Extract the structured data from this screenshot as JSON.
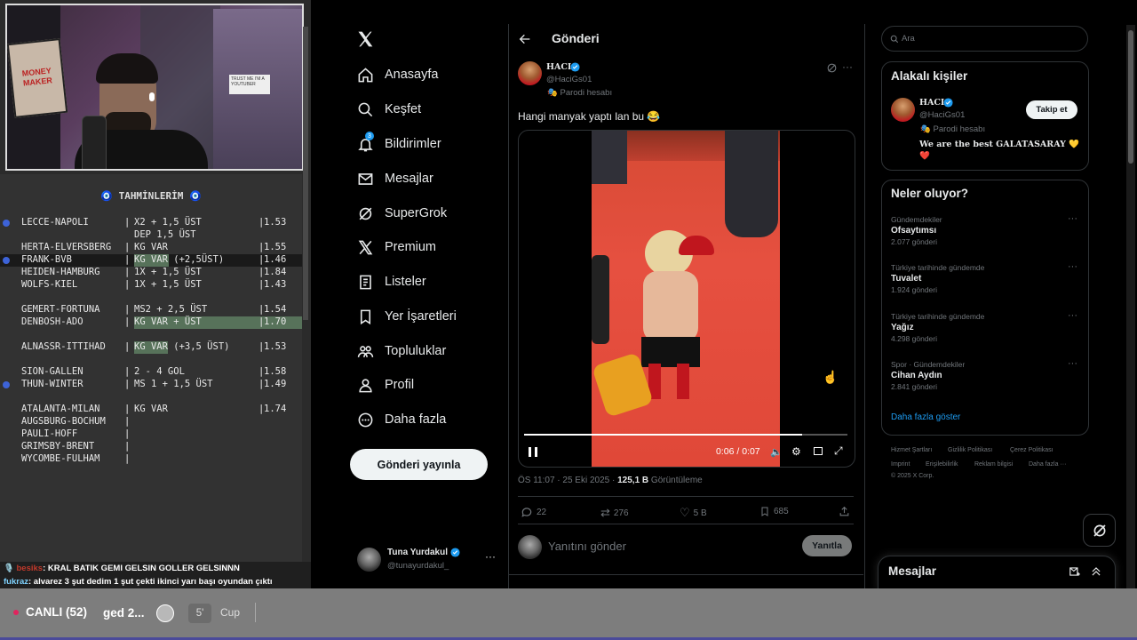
{
  "overlay": {
    "predictions_title": "🧿 TAHMİNLERİM 🧿",
    "rows": [
      {
        "match": "LECCE-NAPOLI",
        "tip": "X2 + 1,5 ÜST",
        "odd": "1.53",
        "dot": true
      },
      {
        "match": "",
        "tip": "DEP 1,5 ÜST",
        "odd": ""
      },
      {
        "match": "HERTA-ELVERSBERG",
        "tip": "KG VAR",
        "odd": "1.55"
      },
      {
        "match": "FRANK-BVB",
        "tip": "KG VAR (+2,5ÜST)",
        "odd": "1.46",
        "dot": true
      },
      {
        "match": "HEIDEN-HAMBURG",
        "tip": "1X + 1,5 ÜST",
        "odd": "1.84"
      },
      {
        "match": "WOLFS-KIEL",
        "tip": "1X + 1,5 ÜST",
        "odd": "1.43"
      },
      {
        "match": "GEMERT-FORTUNA",
        "tip": "MS2 + 2,5 ÜST",
        "odd": "1.54"
      },
      {
        "match": "DENBOSH-ADO",
        "tip": "KG VAR + ÜST",
        "odd": "1.70"
      },
      {
        "match": "ALNASSR-ITTIHAD",
        "tip": "KG VAR (+3,5 ÜST)",
        "odd": "1.53"
      },
      {
        "match": "SION-GALLEN",
        "tip": "2 - 4 GOL",
        "odd": "1.58"
      },
      {
        "match": "THUN-WINTER",
        "tip": "MS 1 + 1,5 ÜST",
        "odd": "1.49",
        "dot": true
      },
      {
        "match": "ATALANTA-MILAN",
        "tip": "KG VAR",
        "odd": "1.74"
      },
      {
        "match": "AUGSBURG-BOCHUM",
        "tip": "",
        "odd": ""
      },
      {
        "match": "PAULI-HOFF",
        "tip": "",
        "odd": ""
      },
      {
        "match": "GRIMSBY-BRENT",
        "tip": "",
        "odd": ""
      },
      {
        "match": "WYCOMBE-FULHAM",
        "tip": "",
        "odd": ""
      }
    ],
    "chat": [
      {
        "user": "besiks",
        "text": ": KRAL BATIK GEMI GELSIN GOLLER GELSINNN"
      },
      {
        "user": "fukraz",
        "text": ": alvarez 3 şut dedim 1 şut çekti ikinci yarı başı oyundan çıktı"
      }
    ],
    "webcam_sign": "MONEY MAKER",
    "webcam_sticker": "TRUST ME I'M A YOUTUBER"
  },
  "nav": {
    "logo": "X",
    "items": [
      {
        "label": "Anasayfa",
        "icon": "home-icon"
      },
      {
        "label": "Keşfet",
        "icon": "search-icon"
      },
      {
        "label": "Bildirimler",
        "icon": "bell-icon",
        "badge": "3"
      },
      {
        "label": "Mesajlar",
        "icon": "mail-icon"
      },
      {
        "label": "SuperGrok",
        "icon": "grok-icon"
      },
      {
        "label": "Premium",
        "icon": "x-logo-icon"
      },
      {
        "label": "Listeler",
        "icon": "list-icon"
      },
      {
        "label": "Yer İşaretleri",
        "icon": "bookmark-icon"
      },
      {
        "label": "Topluluklar",
        "icon": "communities-icon"
      },
      {
        "label": "Profil",
        "icon": "person-icon"
      },
      {
        "label": "Daha fazla",
        "icon": "more-icon"
      }
    ],
    "post_button": "Gönderi yayınla",
    "account_name": "Tuna Yurdakul",
    "account_handle": "@tunayurdakul_"
  },
  "post": {
    "header_title": "Gönderi",
    "author_name": "HACI",
    "author_handle": "@HaciGs01",
    "author_label": "Parodi hesabı",
    "text": "Hangi manyak yaptı lan bu 😂",
    "video_time": "0:06 / 0:07",
    "video_progress": 0.86,
    "timestamp": "ÖS 11:07 · 25 Eki 2025 · ",
    "views_count": "125,1 B",
    "views_label": " Görüntüleme",
    "replies": "22",
    "reposts": "276",
    "likes": "5 B",
    "bookmarks": "685",
    "reply_placeholder": "Yanıtını gönder",
    "reply_button": "Yanıtla"
  },
  "sidebar": {
    "search_placeholder": "Ara",
    "related_title": "Alakalı kişiler",
    "related_name": "HACI",
    "related_handle": "@HaciGs01",
    "related_label": "Parodi hesabı",
    "related_bio": "We are the best GALATASARAY 💛❤️",
    "follow_button": "Takip et",
    "trends_title": "Neler oluyor?",
    "trends": [
      {
        "category": "Gündemdekiler",
        "title": "Ofsaytımsı",
        "count": "2.077 gönderi"
      },
      {
        "category": "Türkiye tarihinde gündemde",
        "title": "Tuvalet",
        "count": "1.924 gönderi"
      },
      {
        "category": "Türkiye tarihinde gündemde",
        "title": "Yağız",
        "count": "4.298 gönderi"
      },
      {
        "category": "Spor · Gündemdekiler",
        "title": "Cihan Aydın",
        "count": "2.841 gönderi"
      }
    ],
    "show_more": "Daha fazla göster",
    "footer_links": [
      "Hizmet Şartları",
      "Gizlilik Politikası",
      "Çerez Politikası",
      "Imprint",
      "Erişilebilirlik",
      "Reklam bilgisi",
      "Daha fazla ···"
    ],
    "copyright": "© 2025 X Corp.",
    "messages_title": "Mesajlar"
  },
  "taskbar": {
    "live": "CANLI (52)",
    "title": "ged 2...",
    "count": "5'",
    "cup": "Cup"
  },
  "colors": {
    "accent": "#1d9bf0",
    "background": "#000000",
    "highlight": "#57725a",
    "live": "#e0245e"
  }
}
